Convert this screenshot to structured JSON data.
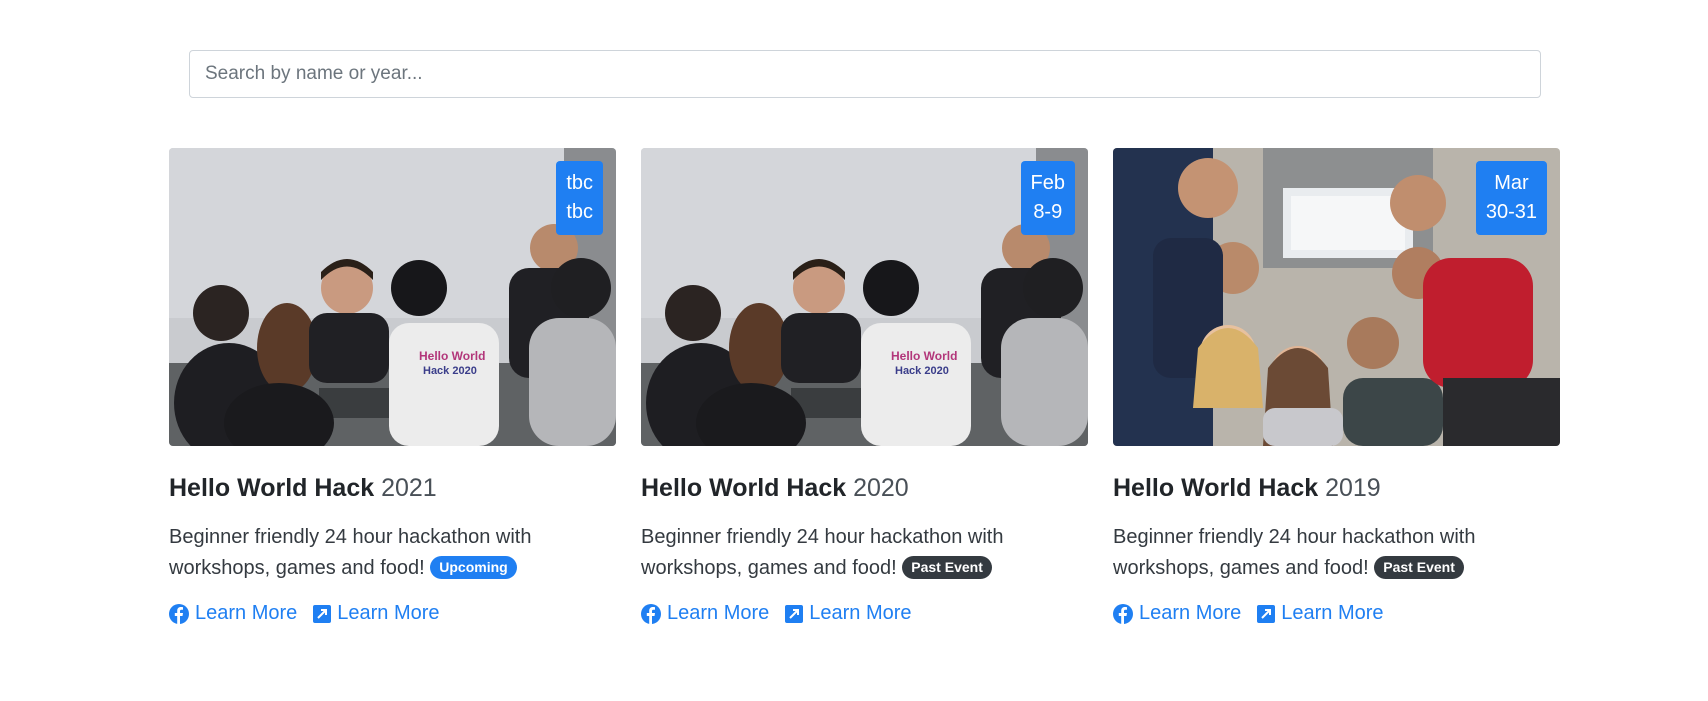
{
  "search": {
    "placeholder": "Search by name or year..."
  },
  "colors": {
    "accent": "#1f7ff2",
    "dark_badge": "#343a40"
  },
  "cards": [
    {
      "name": "Hello World Hack",
      "year": "2021",
      "date_month": "tbc",
      "date_days": "tbc",
      "description": "Beginner friendly 24 hour hackathon with workshops, games and food!",
      "status": "Upcoming",
      "status_kind": "upcoming",
      "image_icon": "team-working-photo",
      "links": [
        {
          "label": "Learn More",
          "icon": "facebook-icon"
        },
        {
          "label": "Learn More",
          "icon": "external-link-icon"
        }
      ]
    },
    {
      "name": "Hello World Hack",
      "year": "2020",
      "date_month": "Feb",
      "date_days": "8-9",
      "description": "Beginner friendly 24 hour hackathon with workshops, games and food!",
      "status": "Past Event",
      "status_kind": "past",
      "image_icon": "team-working-photo",
      "links": [
        {
          "label": "Learn More",
          "icon": "facebook-icon"
        },
        {
          "label": "Learn More",
          "icon": "external-link-icon"
        }
      ]
    },
    {
      "name": "Hello World Hack",
      "year": "2019",
      "date_month": "Mar",
      "date_days": "30-31",
      "description": "Beginner friendly 24 hour hackathon with workshops, games and food!",
      "status": "Past Event",
      "status_kind": "past",
      "image_icon": "group-selfie-photo",
      "links": [
        {
          "label": "Learn More",
          "icon": "facebook-icon"
        },
        {
          "label": "Learn More",
          "icon": "external-link-icon"
        }
      ]
    }
  ]
}
